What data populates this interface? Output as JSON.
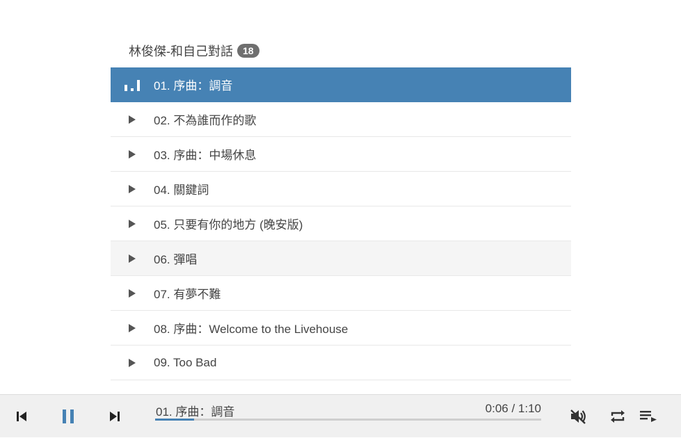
{
  "playlist": {
    "title": "林俊傑-和自己對話",
    "count": "18",
    "tracks": [
      {
        "label": "01. 序曲：調音",
        "state": "playing"
      },
      {
        "label": "02. 不為誰而作的歌",
        "state": "idle"
      },
      {
        "label": "03. 序曲：中場休息",
        "state": "idle"
      },
      {
        "label": "04. 關鍵詞",
        "state": "idle"
      },
      {
        "label": "05. 只要有你的地方 (晚安版)",
        "state": "idle"
      },
      {
        "label": "06. 彈唱",
        "state": "hover"
      },
      {
        "label": "07. 有夢不難",
        "state": "idle"
      },
      {
        "label": "08. 序曲：Welcome to the Livehouse",
        "state": "idle"
      },
      {
        "label": "09. Too Bad",
        "state": "idle"
      }
    ]
  },
  "player": {
    "now_playing": "01. 序曲：調音",
    "time": "0:06 / 1:10",
    "progress": 0.1,
    "controls": [
      "skip-previous-icon",
      "pause-icon",
      "skip-next-icon",
      "volume-off-icon",
      "repeat-icon",
      "playlist-icon"
    ]
  },
  "colors": {
    "accent": "#4682b4",
    "hover_row": "#f5f5f5",
    "bar_bg": "#f0f0f0"
  }
}
